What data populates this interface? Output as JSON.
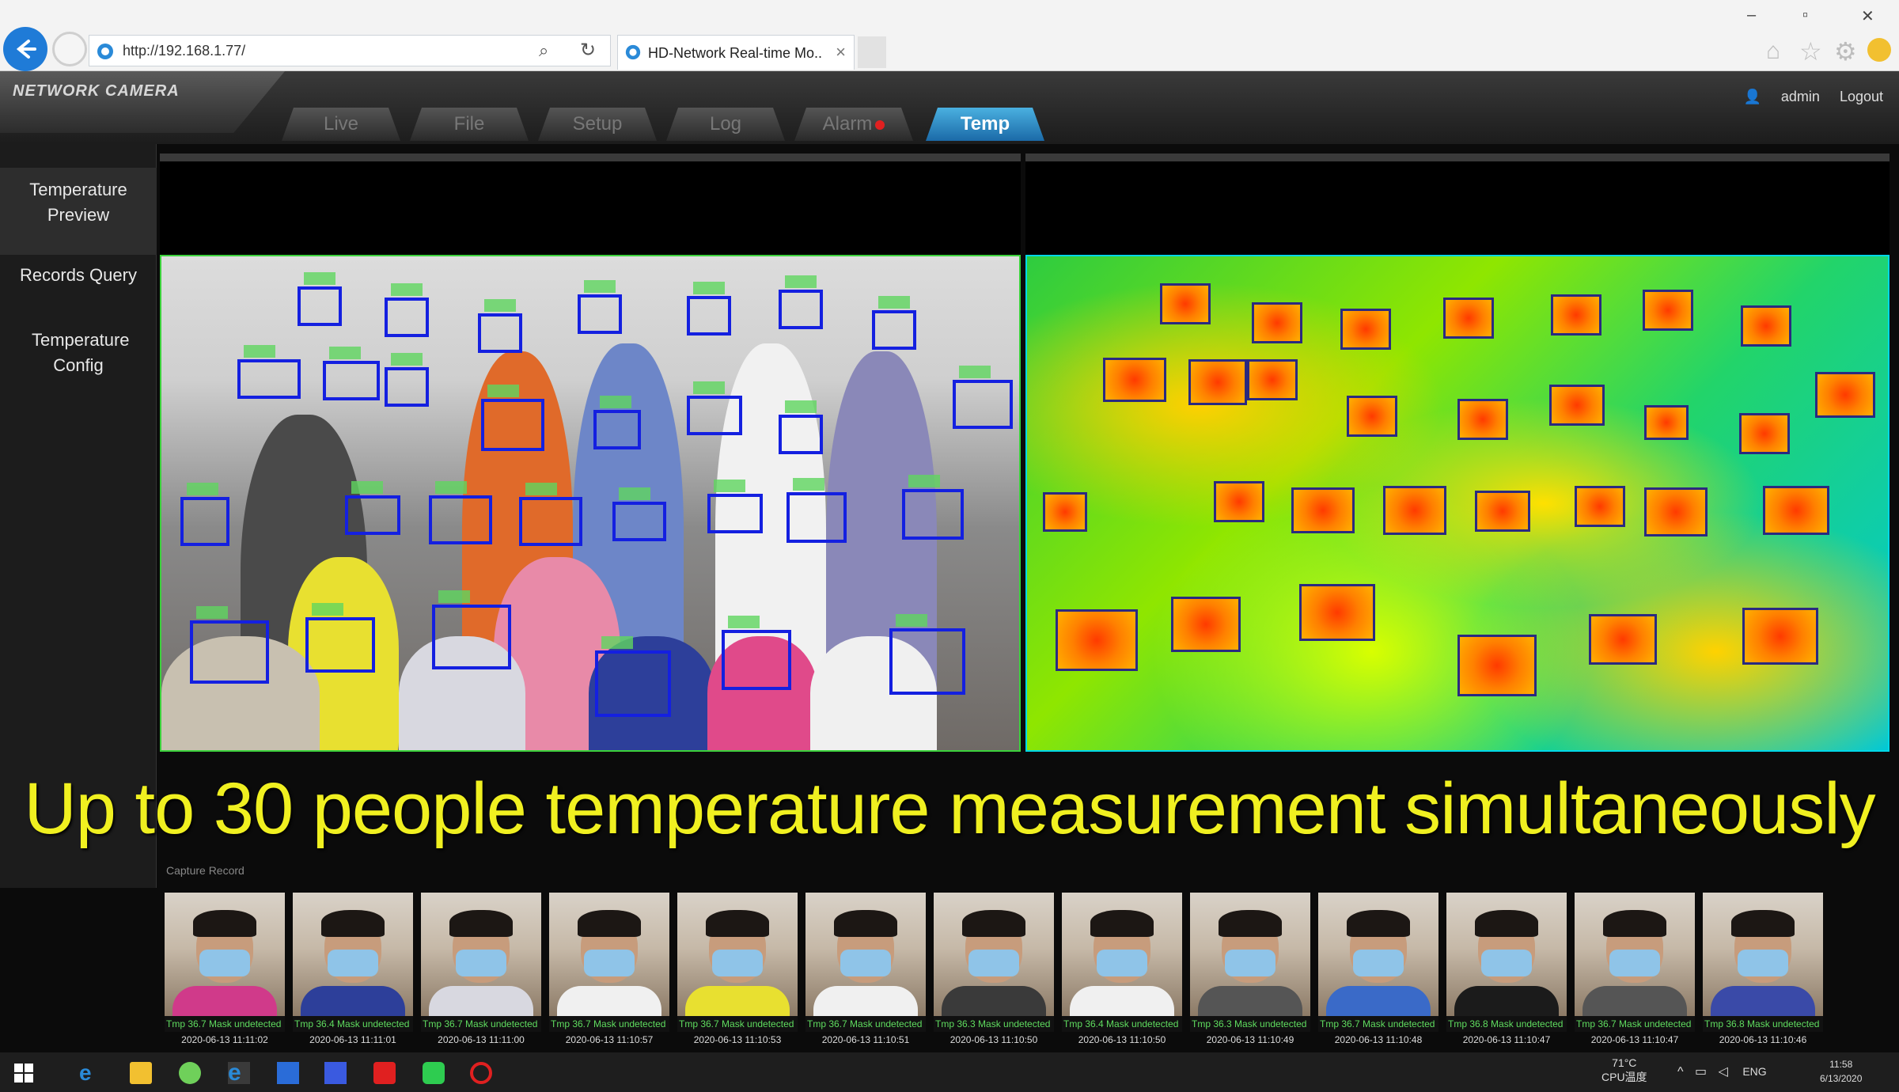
{
  "browser": {
    "url": "http://192.168.1.77/",
    "tab_title": "HD-Network Real-time Mo...",
    "window_controls": [
      "–",
      "▫",
      "✕"
    ]
  },
  "app": {
    "logo_text": "NETWORK CAMERA",
    "nav_tabs": [
      "Live",
      "File",
      "Setup",
      "Log",
      "Alarm",
      "Temp"
    ],
    "active_tab": "Temp",
    "user": "admin",
    "logout": "Logout"
  },
  "left_menu": {
    "items": [
      "Temperature Preview",
      "Records Query",
      "Temperature Config"
    ]
  },
  "caption": "Up to 30 people temperature measurement simultaneously",
  "capture": {
    "label": "Capture Record",
    "items": [
      {
        "info": "Tmp 36.7 Mask undetected",
        "time": "2020-06-13 11:11:02"
      },
      {
        "info": "Tmp 36.4 Mask undetected",
        "time": "2020-06-13 11:11:01"
      },
      {
        "info": "Tmp 36.7 Mask undetected",
        "time": "2020-06-13 11:11:00"
      },
      {
        "info": "Tmp 36.7 Mask undetected",
        "time": "2020-06-13 11:10:57"
      },
      {
        "info": "Tmp 36.7 Mask undetected",
        "time": "2020-06-13 11:10:53"
      },
      {
        "info": "Tmp 36.7 Mask undetected",
        "time": "2020-06-13 11:10:51"
      },
      {
        "info": "Tmp 36.3 Mask undetected",
        "time": "2020-06-13 11:10:50"
      },
      {
        "info": "Tmp 36.4 Mask undetected",
        "time": "2020-06-13 11:10:50"
      },
      {
        "info": "Tmp 36.3 Mask undetected",
        "time": "2020-06-13 11:10:49"
      },
      {
        "info": "Tmp 36.7 Mask undetected",
        "time": "2020-06-13 11:10:48"
      },
      {
        "info": "Tmp 36.8 Mask undetected",
        "time": "2020-06-13 11:10:47"
      },
      {
        "info": "Tmp 36.7 Mask undetected",
        "time": "2020-06-13 11:10:47"
      },
      {
        "info": "Tmp 36.8 Mask undetected",
        "time": "2020-06-13 11:10:46"
      }
    ]
  },
  "taskbar": {
    "cpu_temp": "71°C",
    "cpu_label": "CPU温度",
    "lang": "ENG",
    "time": "11:58",
    "date": "6/13/2020"
  },
  "colors": {
    "accent": "#1b6aa8",
    "caption": "#f0f020",
    "face_box": "#1420e0"
  }
}
